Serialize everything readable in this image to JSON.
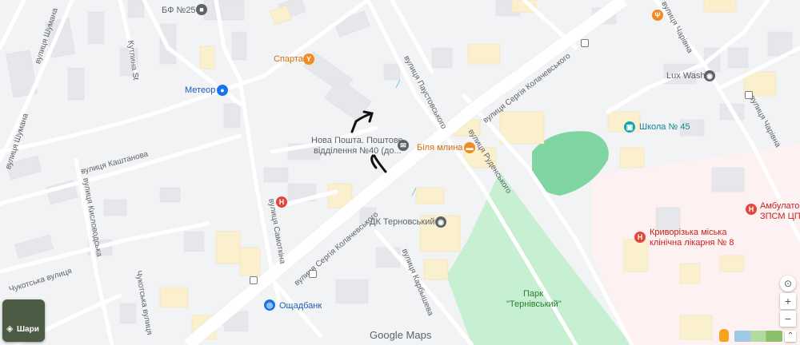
{
  "streets": {
    "shumana": "вулиця Шумана",
    "kaushtanova": "вулиця Каштанова",
    "kyslovodska": "вулиця Кисловодська",
    "chukotska_a": "Чукотська вулиця",
    "chukotska_b": "Чукотська вулиця",
    "samotkina": "вулиця Самоткіна",
    "kolachevskoho_main": "вулиця Сергія Колачевського",
    "kolachevskoho_upper": "вулиця Сергія Колачевського",
    "paustovskoho": "вулиця Паустовського",
    "rudenskoho": "вулиця Руденського",
    "charivna_top": "вулиця Чарівна",
    "charivna_right": "вулиця Чарівна",
    "karbysheva": "вулиця Карбышева",
    "kytlyuna": "Кутлина St",
    "shumana2": "вулиця Шумана"
  },
  "pois": {
    "bf25": "БФ №25",
    "sparta": "Спарта",
    "meteor": "Метеор",
    "nova_poshta": "Нова Пошта. Поштове відділення №40 (до...",
    "nova_poshta_l1": "Нова Пошта. Поштове",
    "nova_poshta_l2": "відділення №40 (до...",
    "bilya_mlyna": "Біля млина",
    "dk_ternovskyi": "ДК Терновський",
    "oshchadbank": "Ощадбанк",
    "lux_wash": "Lux Wash",
    "shkola45": "Школа № 45",
    "ambulatoriia_l1": "Амбулатор",
    "ambulatoriia_l2": "ЗПСМ ЦПМ",
    "likarnia_l1": "Криворізька міська",
    "likarnia_l2": "клінічна лікарня № 8",
    "park_l1": "Парк",
    "park_l2": "\"Тернівський\""
  },
  "controls": {
    "layers_label": "Шари",
    "zoom_in": "+",
    "zoom_out": "−",
    "logo": "Google Maps"
  },
  "icons": {
    "locate": "my-location-icon",
    "layers": "layers-icon",
    "pegman": "pegman-icon"
  },
  "colors": {
    "park": "#c8f0d4",
    "stadium": "#7ed6a0",
    "main_road": "#ffffff",
    "building_yellow": "#fbf1cf",
    "hospital_area": "#fdf2f2",
    "poi_orange": "#f08a24",
    "poi_blue": "#1a73e8",
    "poi_grey": "#5f6368",
    "poi_red": "#e0483b",
    "poi_teal": "#12a4af",
    "text_orange": "#d56e0c",
    "text_red": "#c5221f",
    "text_teal": "#128390",
    "text_blue": "#1a5fb4"
  }
}
